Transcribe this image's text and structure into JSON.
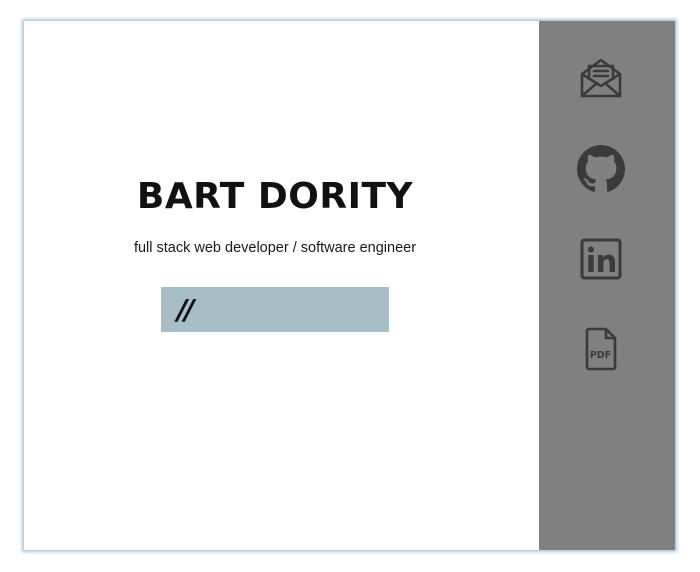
{
  "profile": {
    "name": "BART DORITY",
    "tagline": "full stack web developer / software engineer",
    "prompt": "//"
  },
  "sidebar": {
    "links": [
      {
        "id": "email",
        "icon": "envelope-open-icon"
      },
      {
        "id": "github",
        "icon": "github-icon"
      },
      {
        "id": "linkedin",
        "icon": "linkedin-icon"
      },
      {
        "id": "resume",
        "icon": "pdf-file-icon",
        "label": "PDF"
      }
    ]
  },
  "colors": {
    "sidebar_bg": "#808080",
    "icon_color": "#3a3a3a",
    "prompt_box_bg": "#a8bec6",
    "text": "#111111"
  }
}
